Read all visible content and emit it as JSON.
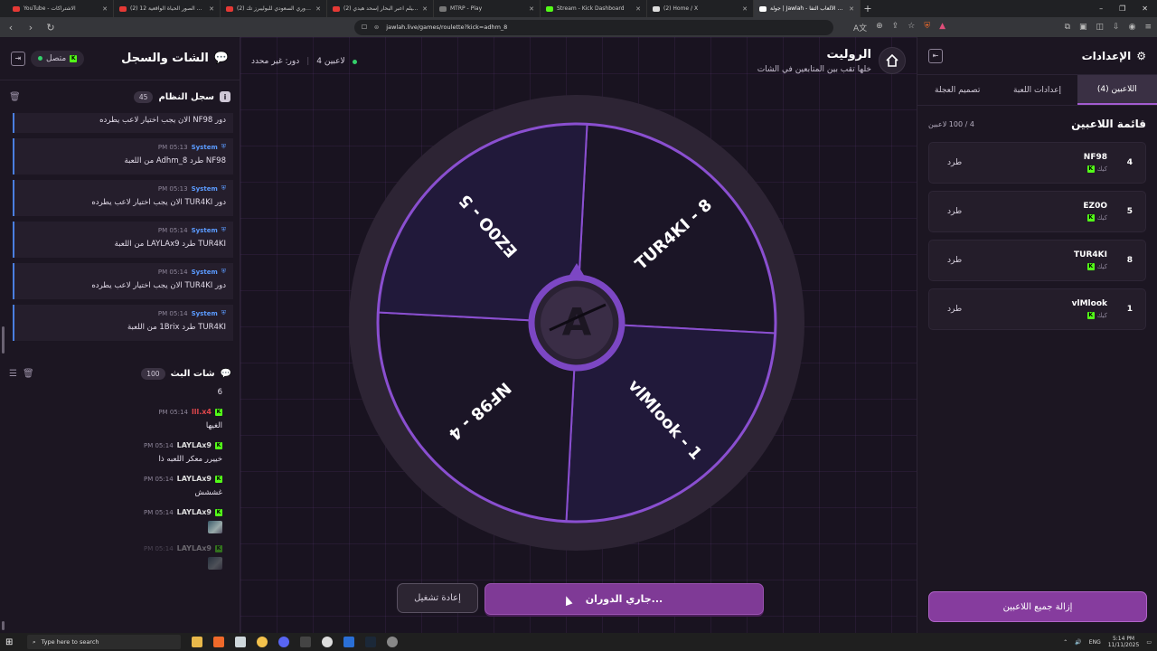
{
  "browser": {
    "tabs": [
      {
        "title": "YouTube - الاشتراكات",
        "color": "#e53935"
      },
      {
        "title": "(2) تحدي الصور الحياة الواقعية 12 🇸🇦",
        "color": "#e53935"
      },
      {
        "title": "(2) بطل الدوري السعودي للبوليبرز تك",
        "color": "#e53935"
      },
      {
        "title": "(2) اغنيه ميلم اعبر البحار إسحد هيدي",
        "color": "#e53935"
      },
      {
        "title": "MTRP - Play",
        "color": "#777777"
      },
      {
        "title": "Stream - Kick Dashboard",
        "color": "#53fc18"
      },
      {
        "title": "(2) Home / X",
        "color": "#dddddd"
      },
      {
        "title": "جولة | Jawlah - منصة الألعاب التفا",
        "color": "#ffffff",
        "active": true
      }
    ],
    "url": "jawlah.live/games/roulette?kick=adhm_8"
  },
  "chat": {
    "title": "الشات والسجل",
    "status": "متصل",
    "system_log": {
      "title": "سجل النظام",
      "count": "45",
      "messages": [
        {
          "time": "",
          "sender": "",
          "text": "دور NF98 الان يجب اختيار لاعب يطرده",
          "partial": true
        },
        {
          "time": "05:13 PM",
          "sender": "System",
          "text": "NF98 طرد Adhm_8 من اللعبة"
        },
        {
          "time": "05:13 PM",
          "sender": "System",
          "text": "دور TUR4KI الان يجب اختيار لاعب يطرده"
        },
        {
          "time": "05:14 PM",
          "sender": "System",
          "text": "TUR4KI طرد LAYLAx9 من اللعبة"
        },
        {
          "time": "05:14 PM",
          "sender": "System",
          "text": "دور TUR4KI الان يجب اختيار لاعب يطرده"
        },
        {
          "time": "05:14 PM",
          "sender": "System",
          "text": "TUR4KI طرد 1Brix من اللعبة"
        }
      ]
    },
    "live_chat": {
      "title": "شات البث",
      "count": "100",
      "messages": [
        {
          "user": "",
          "time": "",
          "text": "6",
          "partial": true
        },
        {
          "user": "lll.x4",
          "user_color": "#e0474c",
          "time": "05:14 PM",
          "text": "الغيها"
        },
        {
          "user": "LAYLAx9",
          "user_color": "#dddddd",
          "time": "05:14 PM",
          "text": "خييرر معكر اللعبه ذا"
        },
        {
          "user": "LAYLAx9",
          "user_color": "#dddddd",
          "time": "05:14 PM",
          "text": "غششش"
        },
        {
          "user": "LAYLAx9",
          "user_color": "#dddddd",
          "time": "05:14 PM",
          "text": "",
          "emote": true
        },
        {
          "user": "LAYLAx9",
          "user_color": "#dddddd",
          "time": "05:14 PM",
          "text": "",
          "emote": true,
          "faded": true
        }
      ]
    }
  },
  "game": {
    "title": "الروليت",
    "subtitle": "خلها تقب بين المتابعين في الشات",
    "players_label": "4 لاعبين",
    "turn_label": "دور: غير محدد",
    "wheel": {
      "segments": [
        {
          "label": "TUR4KI - 8",
          "color": "#1b1526"
        },
        {
          "label": "vlMlook - 1",
          "color": "#21193a"
        },
        {
          "label": "NF98 - 4",
          "color": "#1b1526"
        },
        {
          "label": "EZ0O - 5",
          "color": "#21193a"
        }
      ],
      "rim_color": "#2d2434",
      "stroke_color": "#8a4fd0",
      "hub_letter": "A"
    },
    "spin_label": "جاري الدوران...",
    "restart_label": "إعادة تشغيل"
  },
  "settings": {
    "title": "الإعدادات",
    "tabs": [
      "اللاعبين (4)",
      "إعدادات اللعبة",
      "تصميم العجلة"
    ],
    "active_tab": 0,
    "player_list_title": "قائمة اللاعبين",
    "player_count": "4 / 100 لاعبين",
    "players": [
      {
        "num": "4",
        "name": "NF98",
        "source": "كيك",
        "kick_label": "طرد"
      },
      {
        "num": "5",
        "name": "EZ0O",
        "source": "كيك",
        "kick_label": "طرد"
      },
      {
        "num": "8",
        "name": "TUR4KI",
        "source": "كيك",
        "kick_label": "طرد"
      },
      {
        "num": "1",
        "name": "vlMlook",
        "source": "كيك",
        "kick_label": "طرد"
      }
    ],
    "remove_all_label": "إزالة جميع اللاعبين"
  },
  "taskbar": {
    "search_placeholder": "Type here to search",
    "lang": "ENG",
    "time": "5:14 PM",
    "date": "11/11/2025"
  }
}
